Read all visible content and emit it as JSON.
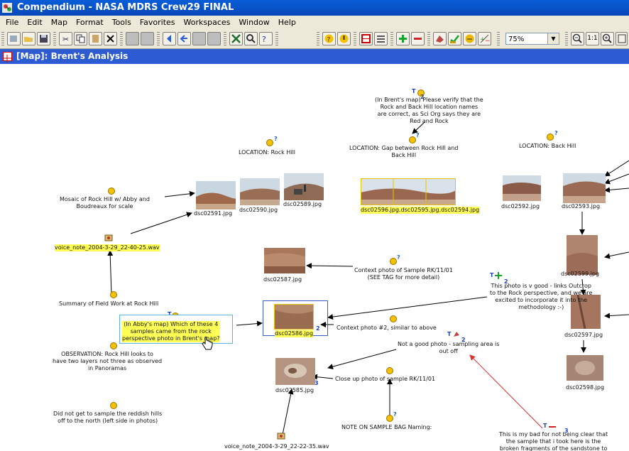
{
  "window": {
    "title": "Compendium - NASA MDRS Crew29 FINAL"
  },
  "menu": [
    "File",
    "Edit",
    "Map",
    "Format",
    "Tools",
    "Favorites",
    "Workspaces",
    "Window",
    "Help"
  ],
  "toolbar": {
    "zoom": "75%",
    "zoom_one_label": "1:1"
  },
  "map": {
    "title": "[Map]: Brent's Analysis",
    "nodes": [
      {
        "text": "(In Brent's map) Please verify that the\nRock and Back Hill  location names\nare correct, as Sci Org says they are\nRed and Rock",
        "badge": "T",
        "count": "2"
      },
      {
        "text": "LOCATION: Rock Hill"
      },
      {
        "text": "LOCATION: Gap between Rock Hill and\nBack Hill"
      },
      {
        "text": "LOCATION:  Back Hill"
      },
      {
        "text": "Mosaic of Rock Hill w/ Abby and\nBoudreaux for scale"
      },
      {
        "text": "dsc02591.jpg"
      },
      {
        "text": "dsc02590.jpg"
      },
      {
        "text": "dsc02589.jpg"
      },
      {
        "text": "dsc02596.jpg"
      },
      {
        "text": "dsc02595.jpg"
      },
      {
        "text": "dsc02594.jpg"
      },
      {
        "text": "dsc02592.jpg"
      },
      {
        "text": "dsc02593.jpg"
      },
      {
        "text": "voice_note_2004-3-29_22-40-25.wav"
      },
      {
        "text": "dsc02587.jpg"
      },
      {
        "text": "Context photo of Sample RK/11/01\n(SEE TAG for more detail)"
      },
      {
        "text": "dsc02599.jpg"
      },
      {
        "text": "This photo is v good - links Outcrop\nto the Rock perspective, and we are\nexcited to incorporate it into the\nmethodology :-)",
        "badge": "T",
        "count": "2"
      },
      {
        "text": "Summary of Field Work at Rock Hill"
      },
      {
        "text": "(In Abby's map) Which of these 4\nsamples came from the rock\nperspective photo in Brent's map?",
        "badge": "T",
        "count": "3"
      },
      {
        "text": "dsc02586.jpg",
        "count": "2"
      },
      {
        "text": "Context photo #2, similar to above"
      },
      {
        "text": "dsc02597.jpg"
      },
      {
        "text": "Not a good photo - sampling area is\nout off",
        "badge": "T",
        "count": "2"
      },
      {
        "text": "OBSERVATION: Rock Hill looks to\nhave two layers not three as observed\nin Panoramas"
      },
      {
        "text": "dsc02585.jpg",
        "count": "3"
      },
      {
        "text": "Close up photo of sample RK/11/01"
      },
      {
        "text": "dsc02598.jpg"
      },
      {
        "text": "Did not get to sample the reddish hills\noff to the north (left side in photos)"
      },
      {
        "text": "NOTE ON SAMPLE BAG Naming:"
      },
      {
        "text": "voice_note_2004-3-29_22-22-35.wav"
      },
      {
        "text": "This is my bad for not being clear that\nthe sample that i took here is the\nbroken fragments of the sandstone to",
        "badge": "T",
        "count": "3"
      }
    ]
  },
  "colors": {
    "title_bar": "#0a5ed8",
    "map_title_bar": "#2c5bd2",
    "highlight": "#ffff55",
    "selection": "#3a5fcd",
    "red_link": "#e03030"
  }
}
